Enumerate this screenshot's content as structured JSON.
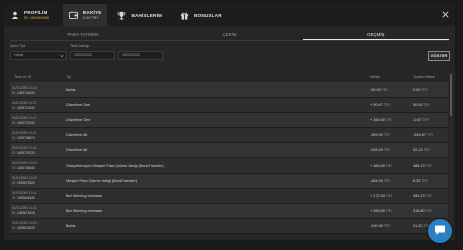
{
  "topnav": {
    "profile": {
      "label": "PROFİLİM",
      "sub": "ID: 190463469",
      "icon": "user-icon"
    },
    "balance": {
      "label": "BAKİYE",
      "sub": "0,00 TRY",
      "icon": "wallet-icon"
    },
    "bets": {
      "label": "BAHİSLERİM",
      "icon": "trophy-icon"
    },
    "bonuses": {
      "label": "BONUSLAR",
      "icon": "gift-icon"
    },
    "close_icon": "close-icon"
  },
  "tabs": [
    "PARA YATIRMA",
    "ÇEKİM",
    "GEÇMİŞ"
  ],
  "filters": {
    "type_label": "İşlem Tipi",
    "type_value": "Hepsi",
    "range_label": "Tarih Aralığı",
    "date_from": "23/02/2020",
    "date_to": "29/02/2020",
    "show_button": "GÖSTER"
  },
  "table": {
    "headers": [
      "Tarih ve ID",
      "Tip",
      "Miktar",
      "Toplam Miktar"
    ],
    "id_label": "ID:",
    "currency": "TRY",
    "rows": [
      {
        "date": "01/01/2000 13:13",
        "id": "1493741834",
        "type": "Bahis",
        "amount": "-50.00",
        "total": "0.00"
      },
      {
        "date": "01/01/2000 13:17",
        "id": "1493710434",
        "type": "Düzeltme Geri",
        "amount": "+ 50.67",
        "total": "50.00"
      },
      {
        "date": "01/01/2000 13:17",
        "id": "1493707530",
        "type": "Düzeltme Geri",
        "amount": "+ 346.00",
        "total": "-0.67"
      },
      {
        "date": "01/01/2000 13:11",
        "id": "1493706574",
        "type": "Düzeltme Alt",
        "amount": "-399.00",
        "total": "-346.67"
      },
      {
        "date": "01/01/2000 13:11",
        "id": "1493707020",
        "type": "Düzeltme Alt",
        "amount": "-434.00",
        "total": "52.13"
      },
      {
        "date": "01/01/2000 13:04",
        "id": "1493706340",
        "type": "Ödeyebeneyen Müşteri Para Çekme İsteği (BankTransfer)",
        "amount": "+ 484.00",
        "total": "486.13"
      },
      {
        "date": "01/01/2000 13:00",
        "id": "1493679322",
        "type": "Müşteri Para Çekme İsteği (BankTransfer)",
        "amount": "-484.00",
        "total": "6.33"
      },
      {
        "date": "01/01/2000 13:11",
        "id": "1493644345",
        "type": "Bet Winning Increase",
        "amount": "+ 172.34",
        "total": "490.13"
      },
      {
        "date": "01/01/2000 13:11",
        "id": "1493674316",
        "type": "Bet Winning Increase",
        "amount": "+ 289.00",
        "total": "318.80"
      },
      {
        "date": "01/01/2000 13:00",
        "id": "1493674626",
        "type": "Bahis",
        "amount": "-100.00",
        "total": "21.20"
      }
    ]
  },
  "colors": {
    "accent": "#e0b23a",
    "chat": "#2b80c4"
  },
  "chat_icon": "chat-bubble-icon"
}
